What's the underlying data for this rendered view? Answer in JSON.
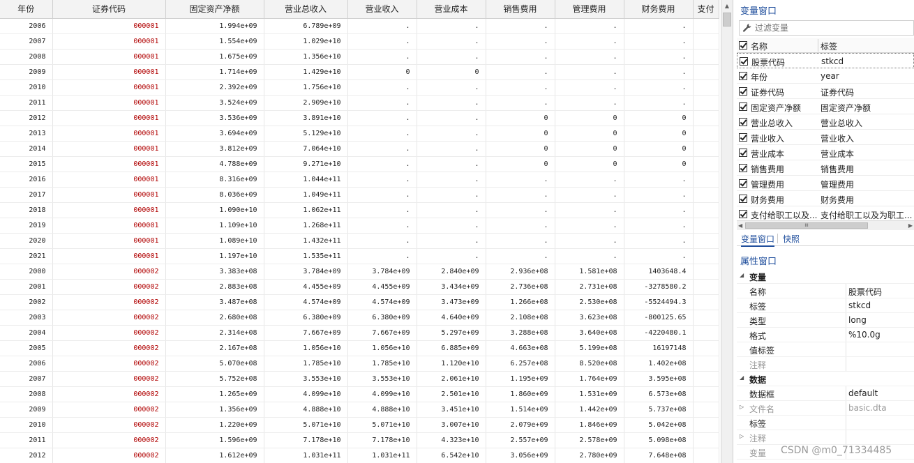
{
  "grid": {
    "columns": [
      "年份",
      "证券代码",
      "固定资产净额",
      "营业总收入",
      "营业收入",
      "营业成本",
      "销售费用",
      "管理费用",
      "财务费用",
      "支付"
    ],
    "rows": [
      [
        "2006",
        "000001",
        "1.994e+09",
        "6.789e+09",
        ".",
        ".",
        ".",
        ".",
        "."
      ],
      [
        "2007",
        "000001",
        "1.554e+09",
        "1.029e+10",
        ".",
        ".",
        ".",
        ".",
        "."
      ],
      [
        "2008",
        "000001",
        "1.675e+09",
        "1.356e+10",
        ".",
        ".",
        ".",
        ".",
        "."
      ],
      [
        "2009",
        "000001",
        "1.714e+09",
        "1.429e+10",
        "0",
        "0",
        ".",
        ".",
        "."
      ],
      [
        "2010",
        "000001",
        "2.392e+09",
        "1.756e+10",
        ".",
        ".",
        ".",
        ".",
        "."
      ],
      [
        "2011",
        "000001",
        "3.524e+09",
        "2.909e+10",
        ".",
        ".",
        ".",
        ".",
        "."
      ],
      [
        "2012",
        "000001",
        "3.536e+09",
        "3.891e+10",
        ".",
        ".",
        "0",
        "0",
        "0"
      ],
      [
        "2013",
        "000001",
        "3.694e+09",
        "5.129e+10",
        ".",
        ".",
        "0",
        "0",
        "0"
      ],
      [
        "2014",
        "000001",
        "3.812e+09",
        "7.064e+10",
        ".",
        ".",
        "0",
        "0",
        "0"
      ],
      [
        "2015",
        "000001",
        "4.788e+09",
        "9.271e+10",
        ".",
        ".",
        "0",
        "0",
        "0"
      ],
      [
        "2016",
        "000001",
        "8.316e+09",
        "1.044e+11",
        ".",
        ".",
        ".",
        ".",
        "."
      ],
      [
        "2017",
        "000001",
        "8.036e+09",
        "1.049e+11",
        ".",
        ".",
        ".",
        ".",
        "."
      ],
      [
        "2018",
        "000001",
        "1.090e+10",
        "1.062e+11",
        ".",
        ".",
        ".",
        ".",
        "."
      ],
      [
        "2019",
        "000001",
        "1.109e+10",
        "1.268e+11",
        ".",
        ".",
        ".",
        ".",
        "."
      ],
      [
        "2020",
        "000001",
        "1.089e+10",
        "1.432e+11",
        ".",
        ".",
        ".",
        ".",
        "."
      ],
      [
        "2021",
        "000001",
        "1.197e+10",
        "1.535e+11",
        ".",
        ".",
        ".",
        ".",
        "."
      ],
      [
        "2000",
        "000002",
        "3.383e+08",
        "3.784e+09",
        "3.784e+09",
        "2.840e+09",
        "2.936e+08",
        "1.581e+08",
        "1403648.4"
      ],
      [
        "2001",
        "000002",
        "2.883e+08",
        "4.455e+09",
        "4.455e+09",
        "3.434e+09",
        "2.736e+08",
        "2.731e+08",
        "-3278580.2"
      ],
      [
        "2002",
        "000002",
        "3.487e+08",
        "4.574e+09",
        "4.574e+09",
        "3.473e+09",
        "1.266e+08",
        "2.530e+08",
        "-5524494.3"
      ],
      [
        "2003",
        "000002",
        "2.680e+08",
        "6.380e+09",
        "6.380e+09",
        "4.640e+09",
        "2.108e+08",
        "3.623e+08",
        "-800125.65"
      ],
      [
        "2004",
        "000002",
        "2.314e+08",
        "7.667e+09",
        "7.667e+09",
        "5.297e+09",
        "3.288e+08",
        "3.640e+08",
        "-4220480.1"
      ],
      [
        "2005",
        "000002",
        "2.167e+08",
        "1.056e+10",
        "1.056e+10",
        "6.885e+09",
        "4.663e+08",
        "5.199e+08",
        "16197148"
      ],
      [
        "2006",
        "000002",
        "5.070e+08",
        "1.785e+10",
        "1.785e+10",
        "1.120e+10",
        "6.257e+08",
        "8.520e+08",
        "1.402e+08"
      ],
      [
        "2007",
        "000002",
        "5.752e+08",
        "3.553e+10",
        "3.553e+10",
        "2.061e+10",
        "1.195e+09",
        "1.764e+09",
        "3.595e+08"
      ],
      [
        "2008",
        "000002",
        "1.265e+09",
        "4.099e+10",
        "4.099e+10",
        "2.501e+10",
        "1.860e+09",
        "1.531e+09",
        "6.573e+08"
      ],
      [
        "2009",
        "000002",
        "1.356e+09",
        "4.888e+10",
        "4.888e+10",
        "3.451e+10",
        "1.514e+09",
        "1.442e+09",
        "5.737e+08"
      ],
      [
        "2010",
        "000002",
        "1.220e+09",
        "5.071e+10",
        "5.071e+10",
        "3.007e+10",
        "2.079e+09",
        "1.846e+09",
        "5.042e+08"
      ],
      [
        "2011",
        "000002",
        "1.596e+09",
        "7.178e+10",
        "7.178e+10",
        "4.323e+10",
        "2.557e+09",
        "2.578e+09",
        "5.098e+08"
      ],
      [
        "2012",
        "000002",
        "1.612e+09",
        "1.031e+11",
        "1.031e+11",
        "6.542e+10",
        "3.056e+09",
        "2.780e+09",
        "7.648e+08"
      ]
    ]
  },
  "variables_window": {
    "title": "变量窗口",
    "filter_placeholder": "过滤变量",
    "header_name": "名称",
    "header_label": "标签",
    "items": [
      {
        "name": "股票代码",
        "label": "stkcd"
      },
      {
        "name": "年份",
        "label": "year"
      },
      {
        "name": "证券代码",
        "label": "证券代码"
      },
      {
        "name": "固定资产净额",
        "label": "固定资产净额"
      },
      {
        "name": "营业总收入",
        "label": "营业总收入"
      },
      {
        "name": "营业收入",
        "label": "营业收入"
      },
      {
        "name": "营业成本",
        "label": "营业成本"
      },
      {
        "name": "销售费用",
        "label": "销售费用"
      },
      {
        "name": "管理费用",
        "label": "管理费用"
      },
      {
        "name": "财务费用",
        "label": "财务费用"
      },
      {
        "name": "支付给职工以及...",
        "label": "支付给职工以及为职工..."
      }
    ],
    "scroll_thumb_text": "III"
  },
  "tabs": {
    "variables": "变量窗口",
    "snapshots": "快照"
  },
  "properties_window": {
    "title": "属性窗口",
    "variable_section": "变量",
    "rows_variable": [
      {
        "key": "名称",
        "value": "股票代码"
      },
      {
        "key": "标签",
        "value": "stkcd"
      },
      {
        "key": "类型",
        "value": "long"
      },
      {
        "key": "格式",
        "value": "%10.0g"
      },
      {
        "key": "值标签",
        "value": ""
      },
      {
        "key": "注释",
        "value": ""
      }
    ],
    "data_section": "数据",
    "rows_data": [
      {
        "key": "数据框",
        "value": "default"
      },
      {
        "key": "文件名",
        "value": "basic.dta"
      },
      {
        "key": "标签",
        "value": ""
      },
      {
        "key": "注释",
        "value": ""
      },
      {
        "key": "变量",
        "value": ""
      }
    ]
  },
  "watermark": "CSDN @m0_71334485"
}
